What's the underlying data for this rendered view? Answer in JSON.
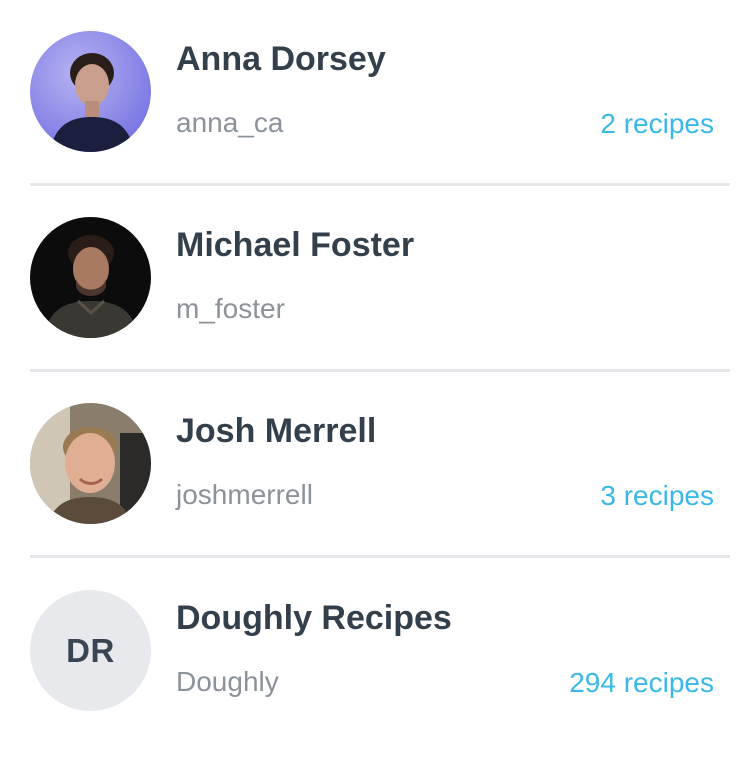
{
  "users": [
    {
      "name": "Anna Dorsey",
      "handle": "anna_ca",
      "recipes": "2 recipes",
      "avatar_icon": "photo-avatar"
    },
    {
      "name": "Michael Foster",
      "handle": "m_foster",
      "recipes": "",
      "avatar_icon": "photo-avatar"
    },
    {
      "name": "Josh Merrell",
      "handle": "joshmerrell",
      "recipes": "3 recipes",
      "avatar_icon": "photo-avatar"
    },
    {
      "name": "Doughly Recipes",
      "handle": "Doughly",
      "recipes": "294 recipes",
      "initials": "DR"
    }
  ],
  "colors": {
    "name_text": "#343f4c",
    "handle_text": "#8c929a",
    "recipe_count": "#3bb8e6",
    "divider": "#e5e7ea",
    "initials_bg": "#e7e9ec"
  }
}
